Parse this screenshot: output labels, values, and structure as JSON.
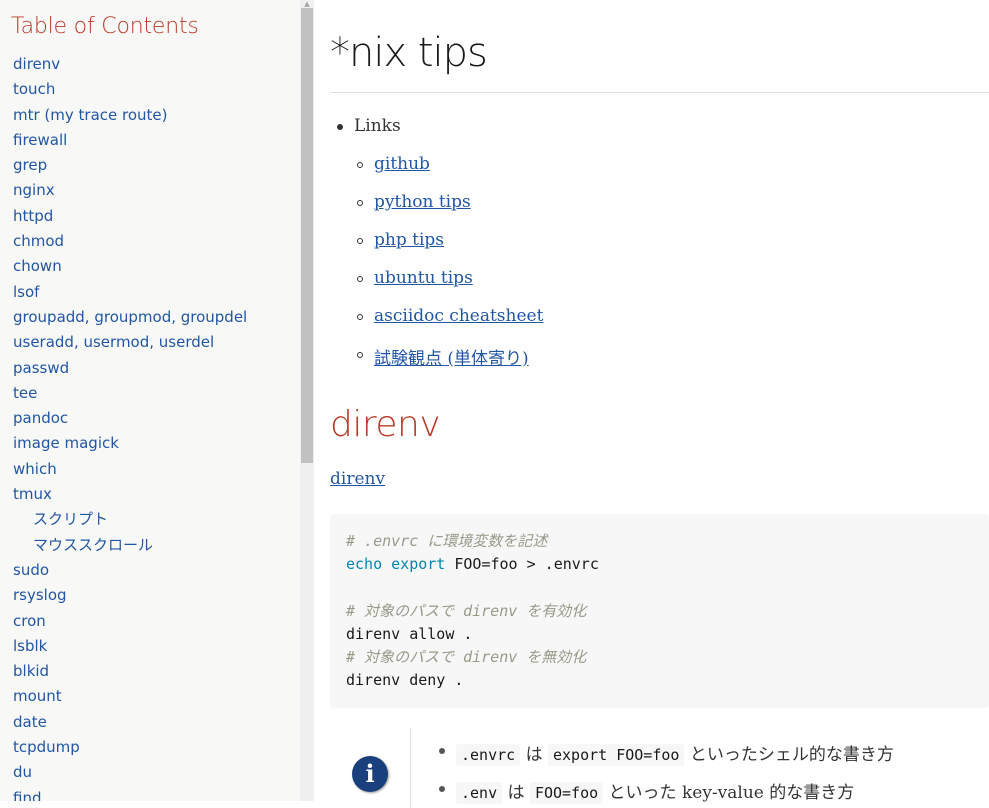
{
  "toc": {
    "title": "Table of Contents",
    "items": [
      {
        "label": "direnv",
        "level": 1
      },
      {
        "label": "touch",
        "level": 1
      },
      {
        "label": "mtr (my trace route)",
        "level": 1
      },
      {
        "label": "firewall",
        "level": 1
      },
      {
        "label": "grep",
        "level": 1
      },
      {
        "label": "nginx",
        "level": 1
      },
      {
        "label": "httpd",
        "level": 1
      },
      {
        "label": "chmod",
        "level": 1
      },
      {
        "label": "chown",
        "level": 1
      },
      {
        "label": "lsof",
        "level": 1
      },
      {
        "label": "groupadd, groupmod, groupdel",
        "level": 1
      },
      {
        "label": "useradd, usermod, userdel",
        "level": 1
      },
      {
        "label": "passwd",
        "level": 1
      },
      {
        "label": "tee",
        "level": 1
      },
      {
        "label": "pandoc",
        "level": 1
      },
      {
        "label": "image magick",
        "level": 1
      },
      {
        "label": "which",
        "level": 1
      },
      {
        "label": "tmux",
        "level": 1
      },
      {
        "label": "スクリプト",
        "level": 2
      },
      {
        "label": "マウススクロール",
        "level": 2
      },
      {
        "label": "sudo",
        "level": 1
      },
      {
        "label": "rsyslog",
        "level": 1
      },
      {
        "label": "cron",
        "level": 1
      },
      {
        "label": "lsblk",
        "level": 1
      },
      {
        "label": "blkid",
        "level": 1
      },
      {
        "label": "mount",
        "level": 1
      },
      {
        "label": "date",
        "level": 1
      },
      {
        "label": "tcpdump",
        "level": 1
      },
      {
        "label": "du",
        "level": 1
      },
      {
        "label": "find",
        "level": 1
      }
    ]
  },
  "page": {
    "title": "*nix tips",
    "links_heading": "Links",
    "links": [
      "github",
      "python tips",
      "php tips",
      "ubuntu tips",
      "asciidoc cheatsheet",
      "試験観点 (単体寄り)"
    ]
  },
  "section": {
    "heading": "direnv",
    "link": "direnv",
    "code": {
      "comment1": "# .envrc に環境変数を記述",
      "kw_echo": "echo",
      "kw_export": "export",
      "line2_rest": " FOO=foo > .envrc",
      "comment2": "# 対象のパスで direnv を有効化",
      "line4": "direnv allow .",
      "comment3": "# 対象のパスで direnv を無効化",
      "line6": "direnv deny ."
    },
    "note": {
      "icon": "info-icon",
      "item1": {
        "code1": ".envrc",
        "t1": " は ",
        "code2": "export FOO=foo",
        "t2": " といったシェル的な書き方"
      },
      "item2": {
        "code1": ".env",
        "t1": " は ",
        "code2": "FOO=foo",
        "t2": " といった key-value 的な書き方"
      }
    }
  },
  "colors": {
    "accent": "#ba3925",
    "link": "#2156a5",
    "info_icon": "#19407c"
  }
}
